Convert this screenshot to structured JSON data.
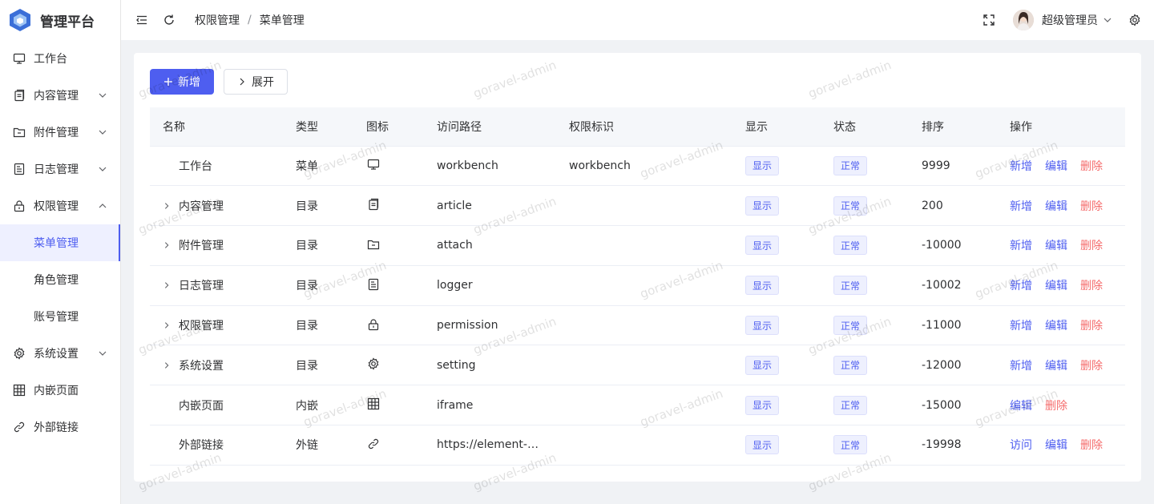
{
  "app": {
    "title": "管理平台"
  },
  "sidebar": {
    "items": [
      {
        "label": "工作台",
        "icon": "monitor-icon",
        "arrow": ""
      },
      {
        "label": "内容管理",
        "icon": "document-icon",
        "arrow": "down"
      },
      {
        "label": "附件管理",
        "icon": "folder-icon",
        "arrow": "down"
      },
      {
        "label": "日志管理",
        "icon": "tickets-icon",
        "arrow": "down"
      },
      {
        "label": "权限管理",
        "icon": "lock-icon",
        "arrow": "up"
      },
      {
        "label": "菜单管理",
        "sub": true,
        "active": true
      },
      {
        "label": "角色管理",
        "sub": true
      },
      {
        "label": "账号管理",
        "sub": true
      },
      {
        "label": "系统设置",
        "icon": "gear-icon",
        "arrow": "down"
      },
      {
        "label": "内嵌页面",
        "icon": "grid-icon",
        "arrow": ""
      },
      {
        "label": "外部链接",
        "icon": "link-icon",
        "arrow": ""
      }
    ]
  },
  "header": {
    "breadcrumb": [
      "权限管理",
      "菜单管理"
    ],
    "separator": "/",
    "user": "超级管理员"
  },
  "toolbar": {
    "add_label": "新增",
    "expand_label": "展开"
  },
  "table": {
    "headers": [
      "名称",
      "类型",
      "图标",
      "访问路径",
      "权限标识",
      "显示",
      "状态",
      "排序",
      "操作"
    ],
    "rows": [
      {
        "name": "工作台",
        "expandable": false,
        "type": "菜单",
        "icon": "monitor-icon",
        "path": "workbench",
        "perm": "workbench",
        "show": "显示",
        "status": "正常",
        "sort": "9999",
        "ops": [
          "新增",
          "编辑",
          "删除"
        ]
      },
      {
        "name": "内容管理",
        "expandable": true,
        "type": "目录",
        "icon": "document-icon",
        "path": "article",
        "perm": "",
        "show": "显示",
        "status": "正常",
        "sort": "200",
        "ops": [
          "新增",
          "编辑",
          "删除"
        ]
      },
      {
        "name": "附件管理",
        "expandable": true,
        "type": "目录",
        "icon": "folder-icon",
        "path": "attach",
        "perm": "",
        "show": "显示",
        "status": "正常",
        "sort": "-10000",
        "ops": [
          "新增",
          "编辑",
          "删除"
        ]
      },
      {
        "name": "日志管理",
        "expandable": true,
        "type": "目录",
        "icon": "tickets-icon",
        "path": "logger",
        "perm": "",
        "show": "显示",
        "status": "正常",
        "sort": "-10002",
        "ops": [
          "新增",
          "编辑",
          "删除"
        ]
      },
      {
        "name": "权限管理",
        "expandable": true,
        "type": "目录",
        "icon": "lock-icon",
        "path": "permission",
        "perm": "",
        "show": "显示",
        "status": "正常",
        "sort": "-11000",
        "ops": [
          "新增",
          "编辑",
          "删除"
        ]
      },
      {
        "name": "系统设置",
        "expandable": true,
        "type": "目录",
        "icon": "gear-icon",
        "path": "setting",
        "perm": "",
        "show": "显示",
        "status": "正常",
        "sort": "-12000",
        "ops": [
          "新增",
          "编辑",
          "删除"
        ]
      },
      {
        "name": "内嵌页面",
        "expandable": false,
        "type": "内嵌",
        "icon": "grid-icon",
        "path": "iframe",
        "perm": "",
        "show": "显示",
        "status": "正常",
        "sort": "-15000",
        "ops": [
          "编辑",
          "删除"
        ]
      },
      {
        "name": "外部链接",
        "expandable": false,
        "type": "外链",
        "icon": "link-icon",
        "path": "https://element-…",
        "perm": "",
        "show": "显示",
        "status": "正常",
        "sort": "-19998",
        "ops": [
          "访问",
          "编辑",
          "删除"
        ]
      }
    ]
  },
  "watermark": "goravel-admin",
  "colors": {
    "primary": "#4e5ef0",
    "danger": "#f56c6c"
  }
}
